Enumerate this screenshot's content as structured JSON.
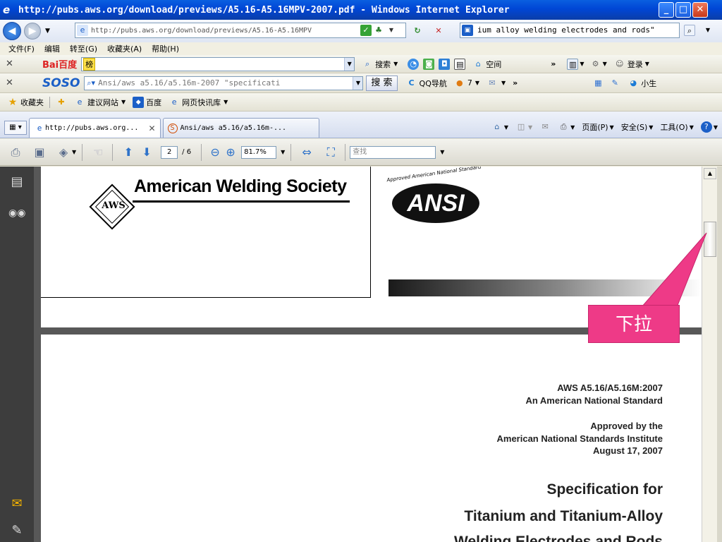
{
  "window": {
    "title": "http://pubs.aws.org/download/previews/A5.16-A5.16MPV-2007.pdf - Windows Internet Explorer",
    "min": "_",
    "max": "□",
    "close": "✕"
  },
  "address": {
    "url": "http://pubs.aws.org/download/previews/A5.16-A5.16MPV",
    "search_text": "ium alloy welding electrodes and rods\""
  },
  "menu": {
    "items": [
      "文件(F)",
      "编辑",
      "转至(G)",
      "收藏夹(A)",
      "帮助(H)"
    ]
  },
  "baidu_bar": {
    "logo": "Bai百度",
    "input_value": "榜",
    "search_label": "搜索",
    "space_label": "空间",
    "more": "»",
    "login_label": "登录"
  },
  "soso_bar": {
    "logo": "SOSO",
    "input_value": "Ansi/aws a5.16/a5.16m-2007 \"specificati",
    "search_button": "搜 索",
    "qq_nav": "QQ导航",
    "badge_count": "7",
    "more": "»",
    "user": "小生"
  },
  "favorites_bar": {
    "favorites": "收藏夹",
    "suggested": "建议网站",
    "baidu": "百度",
    "webslice": "网页快讯库"
  },
  "tabs": [
    {
      "label": "http://pubs.aws.org...",
      "close": "✕"
    },
    {
      "label": "Ansi/aws a5.16/a5.16m-..."
    }
  ],
  "command_bar": {
    "page": "页面(P)",
    "safety": "安全(S)",
    "tools": "工具(O)"
  },
  "pdf_toolbar": {
    "page_current": "2",
    "page_total": "/ 6",
    "zoom": "81.7%",
    "find_placeholder": "查找"
  },
  "document": {
    "aws_mark": "AWS",
    "org_name": "American Welding Society",
    "ansi_arc": "Approved American National Standard",
    "ansi_logo": "ANSI",
    "std_id": "AWS A5.16/A5.16M:2007",
    "std_sub": "An American National Standard",
    "approved1": "Approved by the",
    "approved2": "American National Standards Institute",
    "approved_date": "August 17, 2007",
    "title1": "Specification for",
    "title2": "Titanium and Titanium-Alloy",
    "title3": "Welding Electrodes and Rods"
  },
  "annotation": {
    "label": "下拉",
    "color": "#ee3a87"
  }
}
